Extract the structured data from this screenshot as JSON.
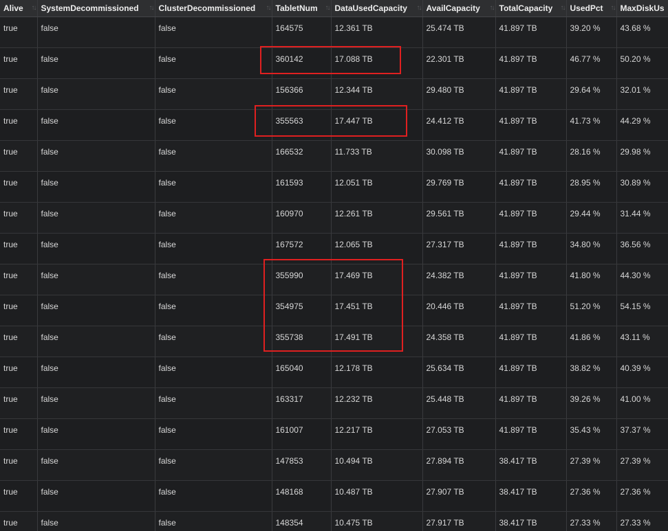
{
  "columns": [
    "Alive",
    "SystemDecommissioned",
    "ClusterDecommissioned",
    "TabletNum",
    "DataUsedCapacity",
    "AvailCapacity",
    "TotalCapacity",
    "UsedPct",
    "MaxDiskUs"
  ],
  "rows": [
    [
      "true",
      "false",
      "false",
      "164575",
      "12.361 TB",
      "25.474 TB",
      "41.897 TB",
      "39.20 %",
      "43.68 %"
    ],
    [
      "true",
      "false",
      "false",
      "360142",
      "17.088 TB",
      "22.301 TB",
      "41.897 TB",
      "46.77 %",
      "50.20 %"
    ],
    [
      "true",
      "false",
      "false",
      "156366",
      "12.344 TB",
      "29.480 TB",
      "41.897 TB",
      "29.64 %",
      "32.01 %"
    ],
    [
      "true",
      "false",
      "false",
      "355563",
      "17.447 TB",
      "24.412 TB",
      "41.897 TB",
      "41.73 %",
      "44.29 %"
    ],
    [
      "true",
      "false",
      "false",
      "166532",
      "11.733 TB",
      "30.098 TB",
      "41.897 TB",
      "28.16 %",
      "29.98 %"
    ],
    [
      "true",
      "false",
      "false",
      "161593",
      "12.051 TB",
      "29.769 TB",
      "41.897 TB",
      "28.95 %",
      "30.89 %"
    ],
    [
      "true",
      "false",
      "false",
      "160970",
      "12.261 TB",
      "29.561 TB",
      "41.897 TB",
      "29.44 %",
      "31.44 %"
    ],
    [
      "true",
      "false",
      "false",
      "167572",
      "12.065 TB",
      "27.317 TB",
      "41.897 TB",
      "34.80 %",
      "36.56 %"
    ],
    [
      "true",
      "false",
      "false",
      "355990",
      "17.469 TB",
      "24.382 TB",
      "41.897 TB",
      "41.80 %",
      "44.30 %"
    ],
    [
      "true",
      "false",
      "false",
      "354975",
      "17.451 TB",
      "20.446 TB",
      "41.897 TB",
      "51.20 %",
      "54.15 %"
    ],
    [
      "true",
      "false",
      "false",
      "355738",
      "17.491 TB",
      "24.358 TB",
      "41.897 TB",
      "41.86 %",
      "43.11 %"
    ],
    [
      "true",
      "false",
      "false",
      "165040",
      "12.178 TB",
      "25.634 TB",
      "41.897 TB",
      "38.82 %",
      "40.39 %"
    ],
    [
      "true",
      "false",
      "false",
      "163317",
      "12.232 TB",
      "25.448 TB",
      "41.897 TB",
      "39.26 %",
      "41.00 %"
    ],
    [
      "true",
      "false",
      "false",
      "161007",
      "12.217 TB",
      "27.053 TB",
      "41.897 TB",
      "35.43 %",
      "37.37 %"
    ],
    [
      "true",
      "false",
      "false",
      "147853",
      "10.494 TB",
      "27.894 TB",
      "38.417 TB",
      "27.39 %",
      "27.39 %"
    ],
    [
      "true",
      "false",
      "false",
      "148168",
      "10.487 TB",
      "27.907 TB",
      "38.417 TB",
      "27.36 %",
      "27.36 %"
    ],
    [
      "true",
      "false",
      "false",
      "148354",
      "10.475 TB",
      "27.917 TB",
      "38.417 TB",
      "27.33 %",
      "27.33 %"
    ]
  ],
  "sort_icon": "sort-arrows-icon",
  "highlight_color": "#e02020"
}
